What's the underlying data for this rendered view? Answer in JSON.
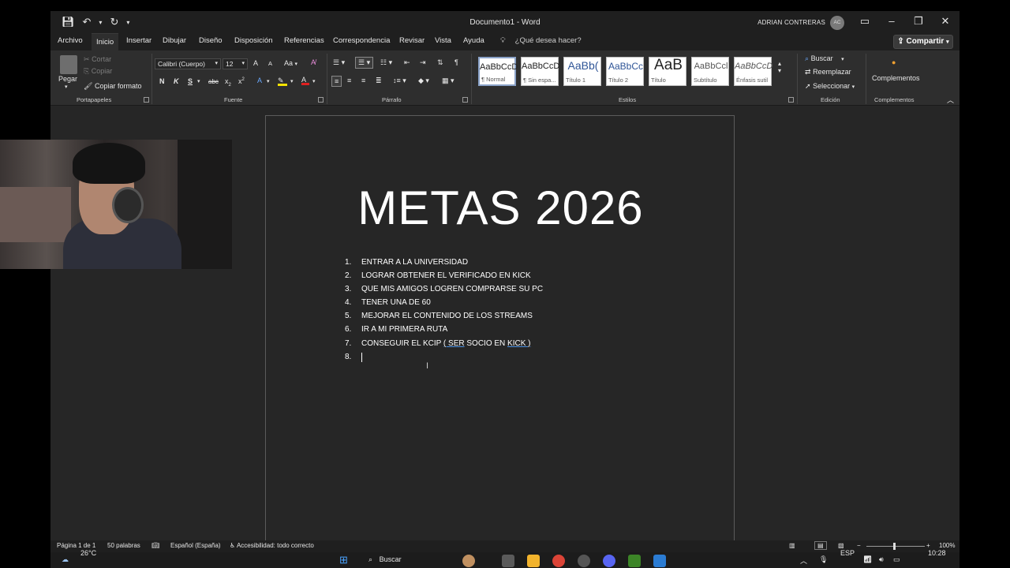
{
  "window": {
    "title": "Documento1 - Word",
    "user_name": "ADRIAN CONTRERAS",
    "avatar_initials": "AC"
  },
  "tabs": [
    "Archivo",
    "Inicio",
    "Insertar",
    "Dibujar",
    "Diseño",
    "Disposición",
    "Referencias",
    "Correspondencia",
    "Revisar",
    "Vista",
    "Ayuda"
  ],
  "active_tab": "Inicio",
  "tell_me": "¿Qué desea hacer?",
  "share_label": "Compartir",
  "ribbon": {
    "clipboard": {
      "paste": "Pegar",
      "cut": "Cortar",
      "copy": "Copiar",
      "format_painter": "Copiar formato",
      "label": "Portapapeles"
    },
    "font": {
      "name": "Calibri (Cuerpo)",
      "size": "12",
      "label": "Fuente",
      "bold": "N",
      "italic": "K",
      "underline": "S",
      "strikethrough": "abc",
      "subscript": "x",
      "superscript": "x",
      "grow": "A",
      "shrink": "A",
      "case": "Aa"
    },
    "paragraph": {
      "label": "Párrafo"
    },
    "styles": {
      "label": "Estilos",
      "items": [
        {
          "preview": "AaBbCcD",
          "name": "¶ Normal"
        },
        {
          "preview": "AaBbCcD",
          "name": "¶ Sin espa..."
        },
        {
          "preview": "AaBb(",
          "name": "Título 1"
        },
        {
          "preview": "AaBbCc",
          "name": "Título 2"
        },
        {
          "preview": "AaB",
          "name": "Título"
        },
        {
          "preview": "AaBbCcl",
          "name": "Subtítulo"
        },
        {
          "preview": "AaBbCcD",
          "name": "Énfasis sutil"
        }
      ]
    },
    "editing": {
      "label": "Edición",
      "find": "Buscar",
      "replace": "Reemplazar",
      "select": "Seleccionar"
    },
    "addins": {
      "button": "Complementos",
      "label": "Complementos"
    }
  },
  "document": {
    "heading": "METAS 2026",
    "items": [
      {
        "num": "1.",
        "text": "ENTRAR A LA UNIVERSIDAD"
      },
      {
        "num": "2.",
        "text": "LOGRAR OBTENER EL VERIFICADO EN KICK"
      },
      {
        "num": "3.",
        "text": "QUE MIS AMIGOS LOGREN COMPRARSE SU PC"
      },
      {
        "num": "4.",
        "text": "TENER UNA DE 60"
      },
      {
        "num": "5.",
        "text": "MEJORAR EL CONTENIDO DE LOS STREAMS"
      },
      {
        "num": "6.",
        "text": "IR A MI PRIMERA RUTA"
      },
      {
        "num": "7.",
        "text_before": "CONSEGUIR EL KCIP ",
        "text_underlined_1": "( SER",
        "text_middle": " SOCIO EN ",
        "text_underlined_2": "KICK )"
      },
      {
        "num": "8.",
        "text": ""
      }
    ]
  },
  "status": {
    "page": "Página 1 de 1",
    "words": "50 palabras",
    "language": "Español (España)",
    "accessibility": "Accesibilidad: todo correcto",
    "zoom": "100%",
    "zoom_minus": "−",
    "zoom_plus": "+"
  },
  "taskbar": {
    "temperature": "26°C",
    "search": "Buscar",
    "language": "ESP",
    "time": "10:28"
  },
  "colors": {
    "app_bg": "#262626",
    "titlebar_bg": "#1f1f1f",
    "ribbon_bg": "#2e2e2e",
    "link_underline": "#4a90e2"
  }
}
